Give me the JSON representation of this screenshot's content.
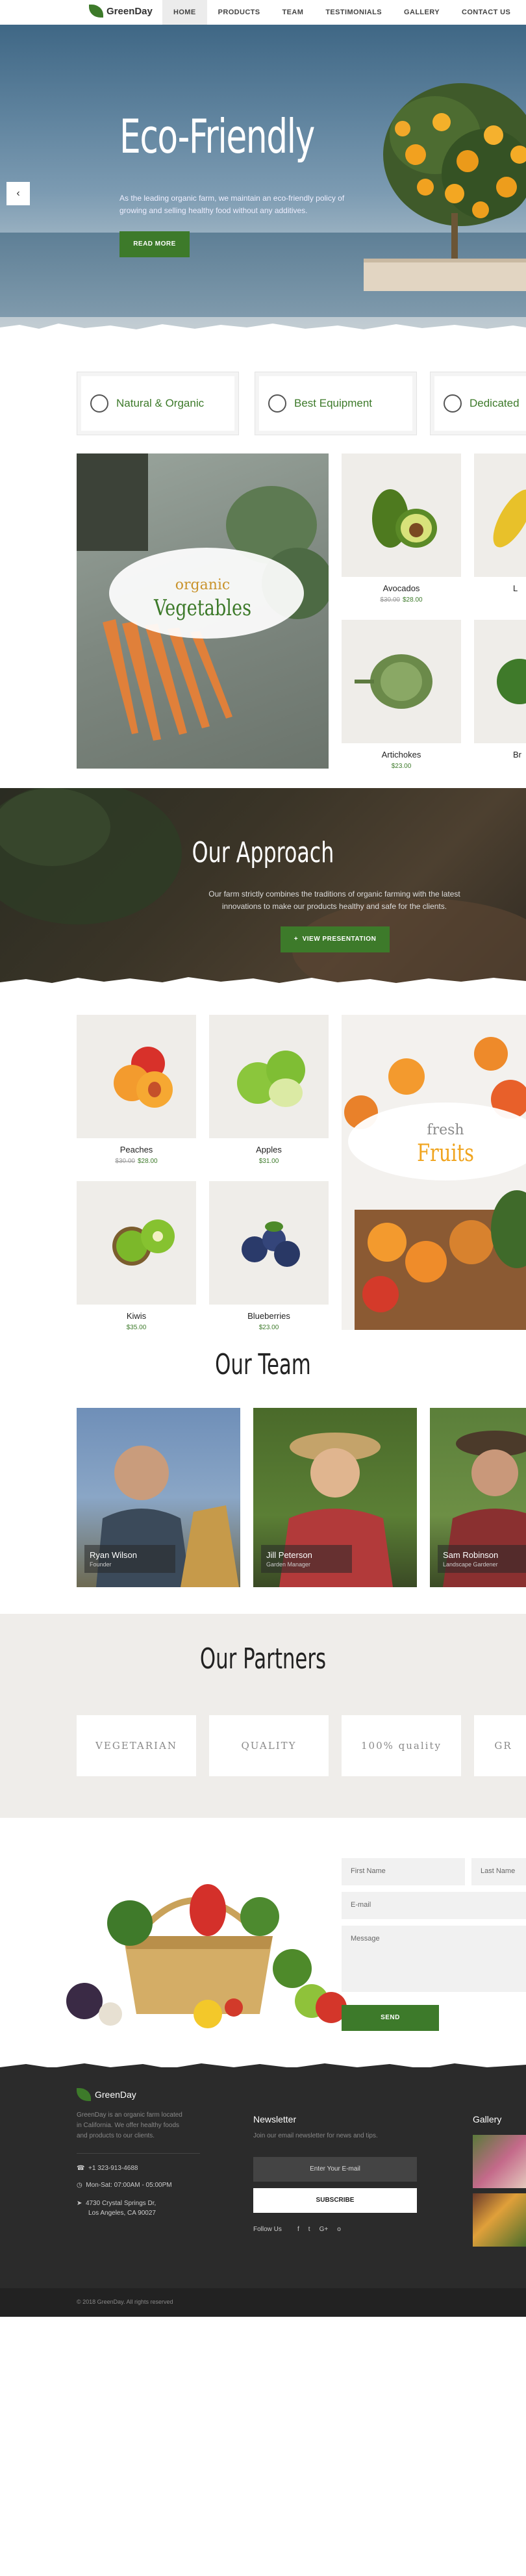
{
  "nav": {
    "brand": "GreenDay",
    "items": [
      {
        "label": "HOME",
        "active": true
      },
      {
        "label": "PRODUCTS"
      },
      {
        "label": "TEAM"
      },
      {
        "label": "TESTIMONIALS"
      },
      {
        "label": "GALLERY"
      },
      {
        "label": "CONTACT US"
      }
    ]
  },
  "hero": {
    "title": "Eco-Friendly",
    "text": "As the leading organic farm, we maintain an eco-friendly policy of growing and selling healthy food without any additives.",
    "button": "READ MORE",
    "prev_icon": "arrow-left-icon"
  },
  "features": [
    {
      "label": "Natural & Organic",
      "icon": "leaf-icon"
    },
    {
      "label": "Best Equipment",
      "icon": "tool-icon"
    },
    {
      "label": "Dedicated",
      "icon": "sun-icon"
    }
  ],
  "promo_vegetables": {
    "line1": "organic",
    "line2": "Vegetables"
  },
  "products_top": [
    {
      "name": "Avocados",
      "old_price": "$30.00",
      "price": "$28.00"
    },
    {
      "name": "Artichokes",
      "price": "$23.00"
    }
  ],
  "products_top_right_partial": [
    {
      "name": "L"
    },
    {
      "name": "Br"
    }
  ],
  "approach": {
    "title": "Our Approach",
    "text": "Our farm strictly combines the traditions of organic farming with the latest innovations to make our products healthy and safe for the clients.",
    "button": "VIEW PRESENTATION",
    "button_icon": "plus-icon"
  },
  "products_bottom": [
    {
      "name": "Peaches",
      "old_price": "$30.00",
      "price": "$28.00"
    },
    {
      "name": "Apples",
      "price": "$31.00"
    },
    {
      "name": "Kiwis",
      "price": "$35.00"
    },
    {
      "name": "Blueberries",
      "price": "$23.00"
    }
  ],
  "promo_fruits": {
    "line1": "fresh",
    "line2": "Fruits"
  },
  "team": {
    "title": "Our Team",
    "members": [
      {
        "name": "Ryan Wilson",
        "role": "Founder"
      },
      {
        "name": "Jill Peterson",
        "role": "Garden Manager"
      },
      {
        "name": "Sam Robinson",
        "role": "Landscape Gardener"
      }
    ]
  },
  "partners": {
    "title": "Our Partners",
    "logos": [
      "VEGETARIAN",
      "QUALITY",
      "100% quality",
      "GR"
    ]
  },
  "contact": {
    "first_name": "First Name",
    "last_name": "Last Name",
    "email": "E-mail",
    "message": "Message",
    "send": "SEND"
  },
  "footer": {
    "brand": "GreenDay",
    "about": "GreenDay is an organic farm located in California. We offer healthy foods and products to our clients.",
    "phone": "+1 323-913-4688",
    "hours": "Mon-Sat: 07:00AM - 05:00PM",
    "address_line1": "4730 Crystal Springs Dr,",
    "address_line2": "Los Angeles, CA 90027",
    "newsletter_title": "Newsletter",
    "newsletter_text": "Join our email newsletter for news and tips.",
    "newsletter_placeholder": "Enter Your E-mail",
    "subscribe": "SUBSCRIBE",
    "follow": "Follow Us",
    "social": [
      "f",
      "t",
      "G+",
      "o"
    ],
    "gallery_title": "Gallery",
    "copyright": "© 2018 GreenDay. All rights reserved"
  }
}
